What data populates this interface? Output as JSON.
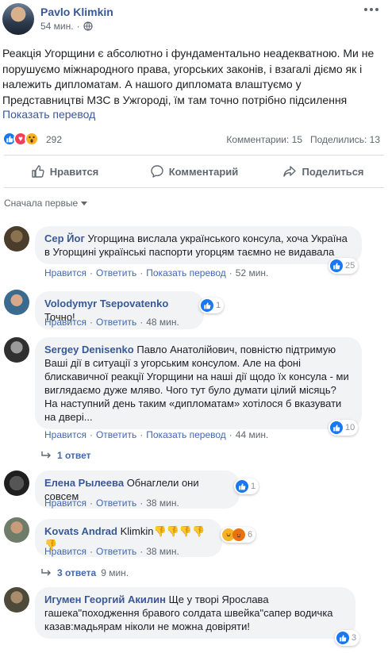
{
  "post": {
    "author": "Pavlo Klimkin",
    "time": "54 мин.",
    "privacy_icon": "globe-icon",
    "text": "Реакція Угорщини є абсолютно і фундаментально неадекватною. Ми не порушуємо міжнародного права, угорських законів, і взагалі діємо як і належить дипломатам. А нашого дипломата влаштуємо у Представництві МЗС в Ужгороді, їм там точно потрібно підсилення",
    "translate": "Показать перевод",
    "reaction_count": "292",
    "comments": "Комментарии: 15",
    "shares": "Поделились: 13"
  },
  "actions": {
    "like": "Нравится",
    "comment": "Комментарий",
    "share": "Поделиться"
  },
  "sort_label": "Сначала первые",
  "comment_actions": {
    "like": "Нравится",
    "reply": "Ответить",
    "translate": "Показать перевод"
  },
  "comments": [
    {
      "name": "Сер Йог",
      "text": "Угорщина вислала українського консула, хоча Україна в Угорщині українські паспорти угорцям таємно не видавала",
      "likes": "25",
      "time": "52 мин.",
      "has_translate": true
    },
    {
      "name": "Volodymyr Tsepovatenko",
      "text": "Точно!",
      "likes": "1",
      "time": "48 мин.",
      "has_translate": false
    },
    {
      "name": "Sergey Denisenko",
      "text": "Павло Анатолійович, повністю підтримую Ваші дії в ситуації з угорським консулом. Але на фоні блискавичної реакції Угорщини на наші дії щодо їх консула - ми виглядаємо дуже мляво. Чого тут було думати цілий місяць? На наступний день таким «дипломатам» хотілося б вказувати на двері...",
      "likes": "10",
      "time": "44 мин.",
      "has_translate": true,
      "replies": "1 ответ"
    },
    {
      "name": "Елена Рылеева",
      "text": "Обнаглели они совсем",
      "likes": "1",
      "time": "38 мин.",
      "has_translate": false
    },
    {
      "name": "Kovats Andrad",
      "text": "Klimkin👎👎👎👎👎",
      "likes": "6",
      "time": "38 мин.",
      "has_translate": false,
      "replies": "3 ответа",
      "replies_time": "9 мин."
    },
    {
      "name": "Игумен Георгий Акилин",
      "text": "Ще у творі Ярослава гашека\"походження бравого солдата швейка\"сапер водичка казав:мадьярам ніколи не можна довіряти!",
      "likes": "3",
      "time": "",
      "has_translate": false
    }
  ],
  "colors": {
    "link": "#385898",
    "like_blue": "#1877f2",
    "bubble": "#f2f3f5",
    "meta": "#606770"
  }
}
